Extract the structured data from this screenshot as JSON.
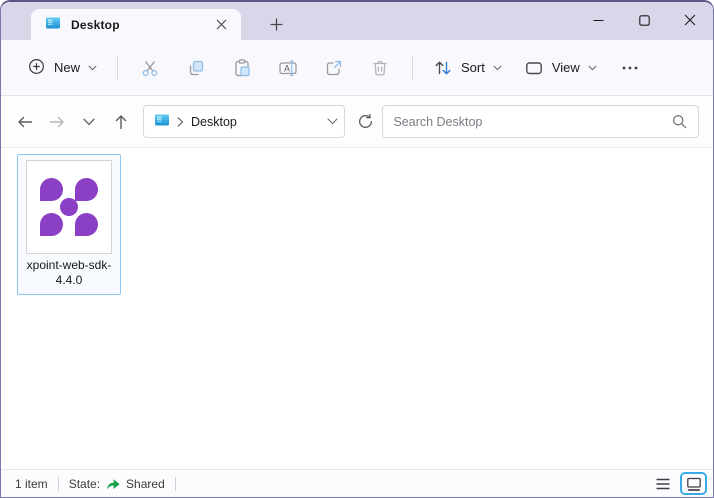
{
  "window": {
    "tab_title": "Desktop",
    "controls": {
      "minimize": "minimize",
      "maximize": "maximize",
      "close": "close"
    }
  },
  "toolbar": {
    "new_label": "New",
    "sort_label": "Sort",
    "view_label": "View",
    "icons": [
      "plus-circle",
      "cut",
      "copy",
      "paste",
      "rename",
      "share",
      "delete",
      "sort-arrows",
      "view-layout",
      "see-more-ellipsis"
    ]
  },
  "navbar": {
    "icons": [
      "back-arrow",
      "forward-arrow",
      "recent-locations-chevron",
      "up-arrow",
      "refresh",
      "search-magnifier"
    ],
    "breadcrumb_location": "Desktop",
    "address_icon": "desktop-folder-icon",
    "search_placeholder": "Search Desktop"
  },
  "content": {
    "items": [
      {
        "name": "xpoint-web-sdk-4.4.0",
        "selected": true,
        "icon": "xpoint-logo",
        "icon_color": "#8a3fc4"
      }
    ]
  },
  "statusbar": {
    "item_count": "1 item",
    "state_label": "State:",
    "state_value": "Shared",
    "state_icon": "shared-green-arrow",
    "view_buttons": [
      "details-view",
      "large-thumbnails-view"
    ],
    "active_view": "large-thumbnails-view"
  },
  "colors": {
    "titlebar_bg": "#d9d6ea",
    "chrome_bg": "#f9f8fc",
    "logo_purple": "#8a3fc4",
    "selection_border": "#8ec7f2",
    "shared_green": "#17a24a",
    "active_view_border": "#3aabe8",
    "accent_blue": "#2f7cd6"
  }
}
